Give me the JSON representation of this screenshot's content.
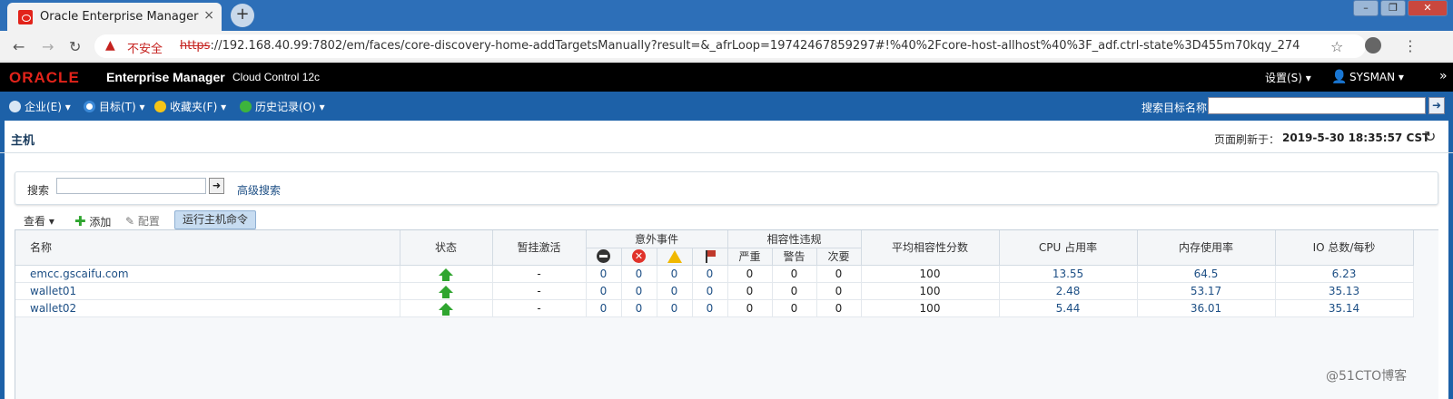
{
  "browser": {
    "tab_title": "Oracle Enterprise Manager",
    "tab_close": "×",
    "new_tab": "+",
    "insecure_label": "不安全",
    "url_scheme": "https",
    "url_rest": "://192.168.40.99:7802/em/faces/core-discovery-home-addTargetsManually?result=&_afrLoop=19742467859297#!%40%2Fcore-host-allhost%40%3F_adf.ctrl-state%3D455m70kqy_274"
  },
  "header": {
    "logo": "ORACLE",
    "product": "Enterprise Manager",
    "edition": "Cloud Control 12c",
    "settings": "设置(S) ▾",
    "user": "SYSMAN ▾",
    "expand": "»"
  },
  "menubar": {
    "items": [
      "企业(E) ▾",
      "目标(T) ▾",
      "收藏夹(F) ▾",
      "历史记录(O) ▾"
    ],
    "search_label": "搜索目标名称",
    "search_go": "➜"
  },
  "page": {
    "title": "主机",
    "refresh_label": "页面刷新于：",
    "refresh_time": "2019-5-30 18:35:57 CST"
  },
  "search": {
    "label": "搜索",
    "go": "➜",
    "advanced": "高级搜索"
  },
  "toolbar": {
    "view": "查看 ▾",
    "add": "添加",
    "configure": "配置",
    "run_host_command": "运行主机命令"
  },
  "table": {
    "headers": {
      "name": "名称",
      "status": "状态",
      "blackout": "暂挂激活",
      "incidents": "意外事件",
      "compliance_violations": "相容性违规",
      "critical": "严重",
      "warning": "警告",
      "minor": "次要",
      "avg_compliance_score": "平均相容性分数",
      "cpu_util": "CPU 占用率",
      "mem_util": "内存使用率",
      "io_per_sec": "IO 总数/每秒"
    },
    "rows": [
      {
        "name": "emcc.gscaifu.com",
        "status": "up",
        "blackout": "-",
        "inc_fatal": "0",
        "inc_critical": "0",
        "inc_warning": "0",
        "inc_escalated": "0",
        "cv_critical": "0",
        "cv_warning": "0",
        "cv_minor": "0",
        "score": "100",
        "cpu": "13.55",
        "mem": "64.5",
        "io": "6.23"
      },
      {
        "name": "wallet01",
        "status": "up",
        "blackout": "-",
        "inc_fatal": "0",
        "inc_critical": "0",
        "inc_warning": "0",
        "inc_escalated": "0",
        "cv_critical": "0",
        "cv_warning": "0",
        "cv_minor": "0",
        "score": "100",
        "cpu": "2.48",
        "mem": "53.17",
        "io": "35.13"
      },
      {
        "name": "wallet02",
        "status": "up",
        "blackout": "-",
        "inc_fatal": "0",
        "inc_critical": "0",
        "inc_warning": "0",
        "inc_escalated": "0",
        "cv_critical": "0",
        "cv_warning": "0",
        "cv_minor": "0",
        "score": "100",
        "cpu": "5.44",
        "mem": "36.01",
        "io": "35.14"
      }
    ]
  },
  "watermark": "@51CTO博客"
}
